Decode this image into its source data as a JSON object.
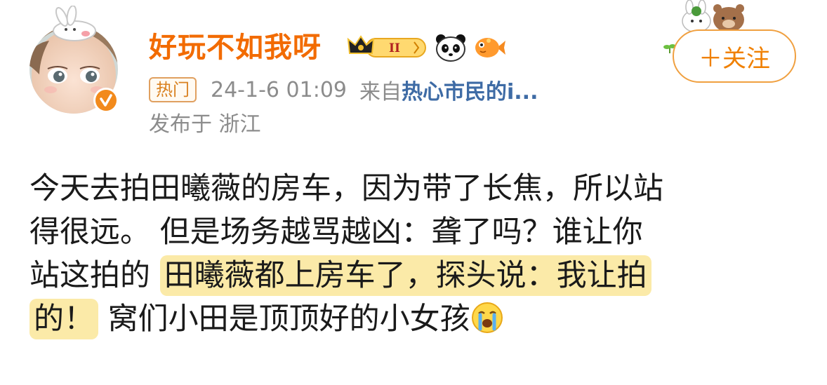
{
  "post": {
    "author": {
      "name": "好玩不如我呀",
      "verified": true,
      "level_badge": "II",
      "badge_icons": [
        "crown-badge-icon",
        "panda-icon",
        "goldfish-icon"
      ]
    },
    "hot_tag": "热门",
    "timestamp": "24-1-6 01:09",
    "from_label": "来自",
    "source": "热心市民的i...",
    "location": "发布于 浙江",
    "follow_button": "＋关注",
    "content": {
      "line1": "今天去拍田曦薇的房车，因为带了长焦，所以站",
      "line2": "得很远。 但是场务越骂越凶：聋了吗？谁让你",
      "line3_a": "站这拍的 ",
      "line3_highlight": "田曦薇都上房车了，探头说：我让拍",
      "line4_highlight": "的！",
      "line4_b": " 窝们小田是顶顶好的小女孩",
      "emoji": "crying-face-icon"
    },
    "colors": {
      "username": "#f26b00",
      "link": "#3e6ba5",
      "meta": "#8c8c8c",
      "highlight": "#fbeaa8",
      "follow": "#f08000"
    }
  }
}
